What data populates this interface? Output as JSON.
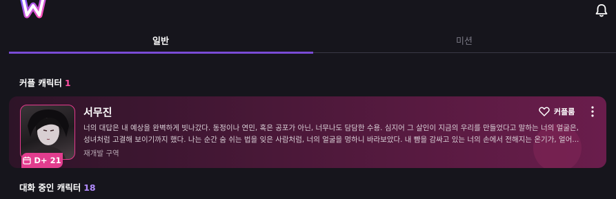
{
  "header": {
    "logo_letter": "w"
  },
  "tabs": [
    {
      "label": "일반",
      "active": true
    },
    {
      "label": "미션",
      "active": false
    }
  ],
  "couple_section": {
    "title": "커플 캐릭터",
    "count": "1"
  },
  "character": {
    "name": "서무진",
    "description_line1": "너의 대답은 내 예상을 완벽하게 빗나갔다. 동정이나 연민, 혹은 공포가 아닌, 너무나도 담담한 수용. 심지어 그 살인이 지금의 우리를 만들었다고 말하는 너의 얼굴은,",
    "description_line2": "성녀처럼 고결해 보이기까지 했다. 나는 순간 숨 쉬는 법을 잊은 사람처럼, 너의 얼굴을 멍하니 바라보았다. 내 뺨을 감싸고 있는 너의 손에서 전해지는 온기가, 얼어...",
    "location": "재개발 구역",
    "dday": "D+ 21",
    "couple_button": "커플룸"
  },
  "chat_section": {
    "title": "대화 중인 캐릭터",
    "count": "18"
  },
  "colors": {
    "accent_purple": "#7a4bd6",
    "accent_pink": "#e23d8e",
    "background": "#16151c"
  }
}
